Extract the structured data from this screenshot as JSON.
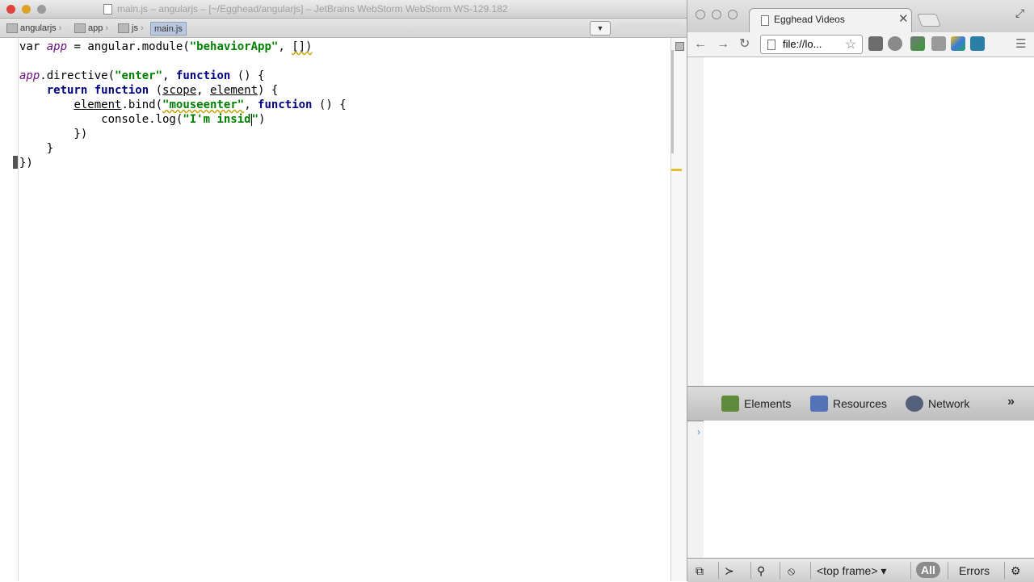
{
  "ide": {
    "window_title": "main.js – angularjs – [~/Egghead/angularjs] – JetBrains WebStorm WebStorm WS-129.182",
    "breadcrumbs": [
      "angularjs",
      "app",
      "js",
      "main.js"
    ],
    "code_lines": [
      "var app = angular.module(\"behaviorApp\", [])",
      "",
      "app.directive(\"enter\", function () {",
      "    return function (scope, element) {",
      "        element.bind(\"mouseenter\", function () {",
      "            console.log(\"I'm insid\")",
      "        })",
      "    }",
      "})"
    ],
    "cursor_line": 6
  },
  "browser": {
    "tab_title": "Egghead Videos",
    "address": "file://lo...",
    "devtools_tabs": [
      "Elements",
      "Resources",
      "Network"
    ],
    "status_bar": {
      "frame_selector": "<top frame>",
      "filter_all": "All",
      "filter_errors": "Errors"
    }
  },
  "icons": {
    "back": "back-arrow-icon",
    "forward": "forward-arrow-icon",
    "reload": "reload-icon",
    "star": "bookmark-star-icon",
    "menu": "hamburger-menu-icon",
    "settings": "gear-icon"
  },
  "colors": {
    "keyword": "#000080",
    "string": "#008000",
    "variable": "#660e7a",
    "current_line": "#fffae3"
  }
}
